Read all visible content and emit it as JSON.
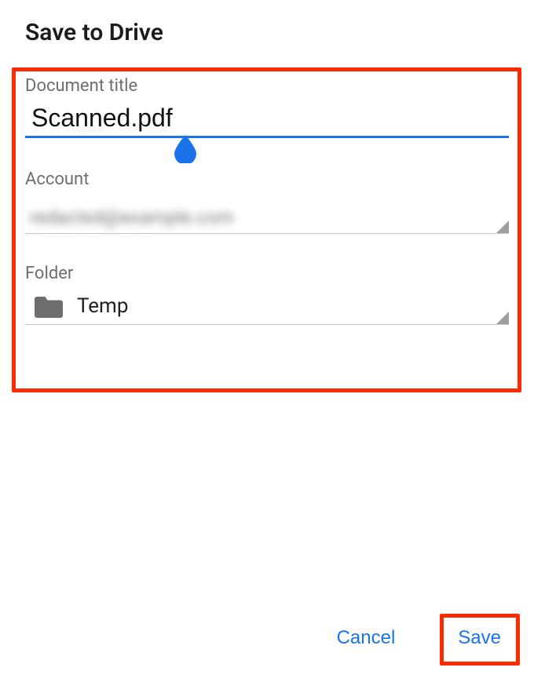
{
  "header": {
    "title": "Save to Drive"
  },
  "fields": {
    "documentTitle": {
      "label": "Document title",
      "value": "Scanned.pdf"
    },
    "account": {
      "label": "Account",
      "value": "redacted@example.com"
    },
    "folder": {
      "label": "Folder",
      "name": "Temp"
    }
  },
  "buttons": {
    "cancel": "Cancel",
    "save": "Save"
  },
  "colors": {
    "accent": "#1a73e8",
    "highlight": "#ff2a00"
  }
}
